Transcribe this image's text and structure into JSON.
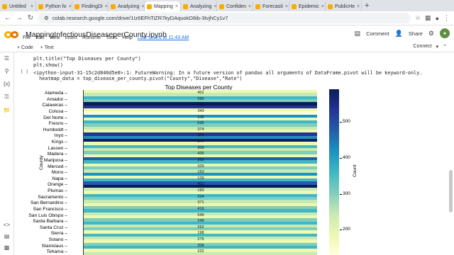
{
  "browser": {
    "tabs": [
      {
        "label": "Untitled"
      },
      {
        "label": "Python fo"
      },
      {
        "label": "FindingDi"
      },
      {
        "label": "Analyzing"
      },
      {
        "label": "Mapping",
        "active": true
      },
      {
        "label": "Analyzing"
      },
      {
        "label": "Confiden"
      },
      {
        "label": "Forecasti"
      },
      {
        "label": "Epidemic"
      },
      {
        "label": "PublicHe"
      }
    ],
    "url": "colab.research.google.com/drive/1Iz6EFhTiZR7kyDAquokD8ib-3tvjhCy1v7"
  },
  "notebook": {
    "title": "MappingInfectiousDiseaseperCounty.ipynb",
    "menus": [
      "File",
      "Edit",
      "View",
      "Insert",
      "Runtime",
      "Tools",
      "Help"
    ],
    "saved_text": "Last saved at 11:43 AM",
    "comment_label": "Comment",
    "share_label": "Share",
    "add_code": "+ Code",
    "add_text": "+ Text",
    "connect_label": "Connect"
  },
  "cell": {
    "line0": "plt.title(\"Top Diseases per County\")",
    "line1": "plt.show()",
    "exec_count": "[ ]",
    "warning_line1": "<ipython-input-31-15c2d840d5e0>:1: FutureWarning: In a future version of pandas all arguments of DataFrame.pivot will be keyword-only.",
    "warning_line2": "  heatmap_data = top_disease_per_county.pivot(\"County\",\"Disease\",\"Rate\")"
  },
  "chart_data": {
    "type": "heatmap",
    "title": "Top Diseases per County",
    "ylabel": "County",
    "colorbar_label": "Count",
    "colorbar_ticks": [
      500,
      400,
      300,
      200
    ],
    "counties": [
      "Alameda",
      "Amador",
      "Calaveras",
      "Colusa",
      "Del Norte",
      "Fresno",
      "Humboldt",
      "Inyo",
      "Kings",
      "Lassen",
      "Madera",
      "Mariposa",
      "Merced",
      "Mono",
      "Napa",
      "Orange",
      "Plumas",
      "Sacramento",
      "San Bernardino",
      "San Francisco",
      "San Luis Obispo",
      "Santa Barbara",
      "Santa Cruz",
      "Sierra",
      "Solano",
      "Stanislaus",
      "Tehama"
    ],
    "colors": [
      "#edf8b1",
      "#c7e9b4",
      "#41b6c4",
      "#7fcdbb",
      "#081d58",
      "#253494",
      "#edf8b1",
      "#ffffd9",
      "#1d91c0",
      "#edf8b1",
      "#41b6c4",
      "#7fcdbb",
      "#c7e9b4",
      "#edf8b1",
      "#253494",
      "#1d91c0",
      "#081d58",
      "#edf8b1",
      "#41b6c4",
      "#c7e9b4",
      "#7fcdbb",
      "#edf8b1",
      "#225ea8",
      "#41b6c4",
      "#edf8b1",
      "#7fcdbb",
      "#c7e9b4",
      "#1d91c0",
      "#edf8b1",
      "#41b6c4",
      "#225ea8",
      "#081d58",
      "#c7e9b4",
      "#edf8b1",
      "#41b6c4",
      "#7fcdbb",
      "#c7e9b4",
      "#edf8b1",
      "#7fcdbb",
      "#41b6c4",
      "#c7e9b4",
      "#edf8b1",
      "#7fcdbb",
      "#41b6c4",
      "#c7e9b4",
      "#7fcdbb",
      "#edf8b1",
      "#41b6c4",
      "#c7e9b4",
      "#edf8b1",
      "#7fcdbb",
      "#41b6c4",
      "#edf8b1",
      "#c7e9b4"
    ],
    "annotations": [
      "401",
      "295",
      "503",
      "343",
      "142",
      "535",
      "374",
      "360",
      "544",
      "303",
      "426",
      "262",
      "329",
      "153",
      "129",
      "401",
      "183",
      "224",
      "371",
      "416",
      "549",
      "249",
      "252",
      "198",
      "275",
      "308",
      "222"
    ]
  }
}
